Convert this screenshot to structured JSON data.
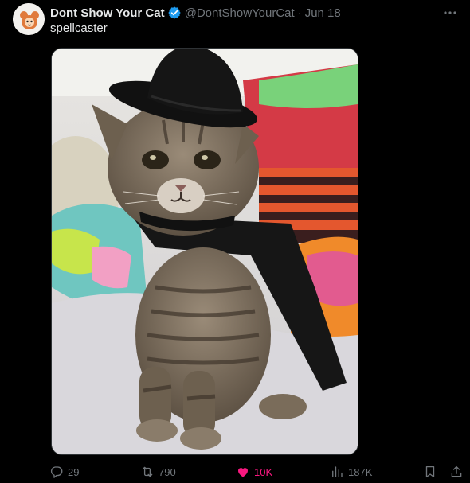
{
  "tweet": {
    "display_name": "Dont Show Your Cat",
    "handle": "@DontShowYourCat",
    "separator": "·",
    "date": "Jun 18",
    "text": "spellcaster"
  },
  "actions": {
    "replies": "29",
    "reposts": "790",
    "likes": "10K",
    "views": "187K"
  },
  "icons": {
    "verified": "verified-badge-icon",
    "more": "more-horizontal-icon",
    "reply": "reply-icon",
    "repost": "repost-icon",
    "like": "heart-icon",
    "views": "views-bar-chart-icon",
    "bookmark": "bookmark-icon",
    "share": "share-icon"
  },
  "colors": {
    "background": "#000000",
    "text": "#e7e9ea",
    "muted": "#71767b",
    "verified": "#1d9bf0",
    "like_active": "#f91880"
  }
}
